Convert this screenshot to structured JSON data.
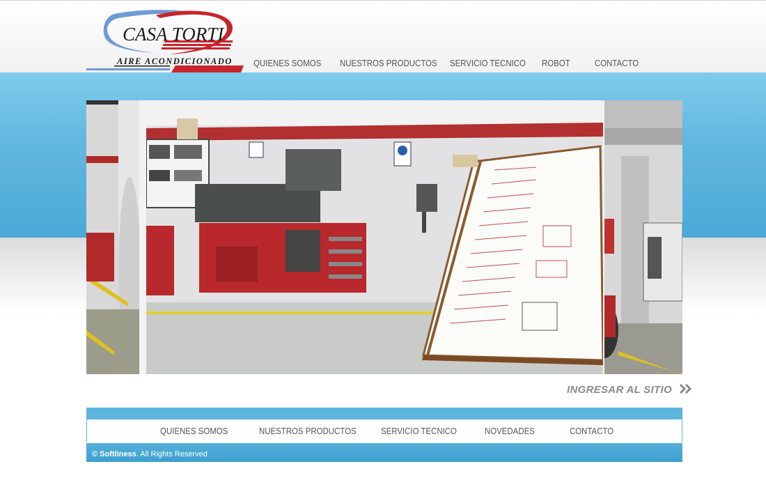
{
  "logo": {
    "title": "CASA TORTI",
    "subtitle": "AIRE  ACONDICIONADO"
  },
  "nav": {
    "items": [
      "QUIENES SOMOS",
      "NUESTROS PRODUCTOS",
      "SERVICIO TECNICO",
      "ROBOT",
      "CONTACTO"
    ]
  },
  "enter": {
    "label": "INGRESAR AL SITIO"
  },
  "footer_nav": {
    "items": [
      "QUIENES SOMOS",
      "NUESTROS PRODUCTOS",
      "SERVICIO TECNICO",
      "NOVEDADES",
      "CONTACTO"
    ]
  },
  "footer": {
    "brand": "© Softliness",
    "rights": ". All Rights Reserved"
  },
  "colors": {
    "accent_blue": "#5cb5df",
    "logo_red": "#c8242b",
    "logo_blue": "#5a8fd0",
    "nav_text": "#555555",
    "enter_text": "#8a8a8a"
  }
}
